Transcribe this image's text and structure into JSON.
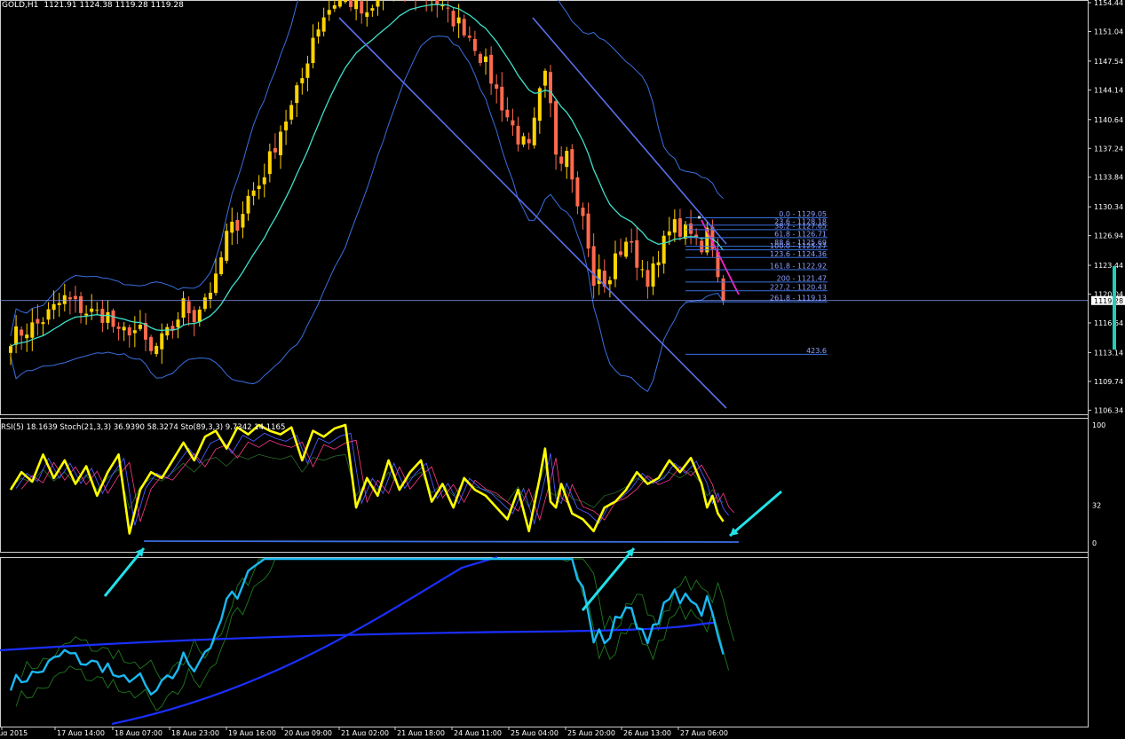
{
  "header": {
    "symbol": "GOLD,H1",
    "ohlc": "1121.91 1124.38 1119.28 1119.28",
    "current_price": "1119.28"
  },
  "rsi_header": {
    "label": "RSI(5) 18.1639  Stoch(21,3,3) 36.9390 58.3274  Sto(89,3,3) 9.7342 14.1165"
  },
  "rsi_axis_labels": [
    "100",
    "32",
    "0"
  ],
  "price_axis_labels": [
    "1154.44",
    "1151.04",
    "1147.54",
    "1144.14",
    "1140.64",
    "1137.24",
    "1133.84",
    "1130.34",
    "1126.94",
    "1123.44",
    "1120.04",
    "1116.64",
    "1113.14",
    "1109.74",
    "1106.34"
  ],
  "time_labels": [
    "14 Aug 2015",
    "17 Aug 14:00",
    "18 Aug 07:00",
    "18 Aug 23:00",
    "19 Aug 16:00",
    "20 Aug 09:00",
    "21 Aug 02:00",
    "21 Aug 18:00",
    "24 Aug 11:00",
    "25 Aug 04:00",
    "25 Aug 20:00",
    "26 Aug 13:00",
    "27 Aug 06:00"
  ],
  "fib_levels": [
    {
      "label": "0.0 - 1129.05",
      "price": 1129.05
    },
    {
      "label": "23.6 - 1128.18",
      "price": 1128.18
    },
    {
      "label": "38.2 - 1127.65",
      "price": 1127.65
    },
    {
      "label": "61.8 - 1126.71",
      "price": 1126.71
    },
    {
      "label": "88.6 - 1125.69",
      "price": 1125.69
    },
    {
      "label": "100.0 - 1125.27",
      "price": 1125.27
    },
    {
      "label": "123.6 - 1124.36",
      "price": 1124.36
    },
    {
      "label": "161.8 - 1122.92",
      "price": 1122.92
    },
    {
      "label": "200 - 1121.47",
      "price": 1121.47
    },
    {
      "label": "227.2 - 1120.43",
      "price": 1120.43
    },
    {
      "label": "261.8 - 1119.13",
      "price": 1119.13
    },
    {
      "label": "423.6",
      "price": 1112.94
    }
  ],
  "colors": {
    "background": "#000000",
    "bull_candle": "#ffd400",
    "bear_candle": "#ff6a4d",
    "ema": "#3fe0c8",
    "bands": "#3a6fe0",
    "trendline": "#5a6ee8",
    "magenta": "#ff22cc",
    "rsi_yellow": "#ffff00",
    "cyan_arrow": "#22e0e8",
    "lower_cyan": "#1ab8f0",
    "lower_blue": "#1a2fff",
    "lower_green": "#1f7a1f",
    "price_line": "#8aa0ff",
    "axis_text": "#ffffff"
  },
  "chart_data": [
    {
      "type": "candlestick",
      "title": "GOLD,H1",
      "ylim": [
        1106.34,
        1154.44
      ],
      "yticks": [
        1154.44,
        1151.04,
        1147.54,
        1144.14,
        1140.64,
        1137.24,
        1133.84,
        1130.34,
        1126.94,
        1123.44,
        1120.04,
        1116.64,
        1113.14,
        1109.74,
        1106.34
      ],
      "x_ticks": [
        "14 Aug 2015",
        "17 Aug 14:00",
        "18 Aug 07:00",
        "18 Aug 23:00",
        "19 Aug 16:00",
        "20 Aug 09:00",
        "21 Aug 02:00",
        "21 Aug 18:00",
        "24 Aug 11:00",
        "25 Aug 04:00",
        "25 Aug 20:00",
        "26 Aug 13:00",
        "27 Aug 06:00"
      ],
      "close_path": [
        [
          0,
          1115.0
        ],
        [
          5,
          1116.5
        ],
        [
          10,
          1119.5
        ],
        [
          14,
          1118.0
        ],
        [
          18,
          1117.5
        ],
        [
          20,
          1115.0
        ],
        [
          22,
          1116.0
        ],
        [
          24,
          1115.5
        ],
        [
          26,
          1113.0
        ],
        [
          28,
          1114.5
        ],
        [
          30,
          1116.0
        ],
        [
          32,
          1118.8
        ],
        [
          34,
          1117.5
        ],
        [
          36,
          1119.8
        ],
        [
          38,
          1121.5
        ],
        [
          40,
          1127.0
        ],
        [
          42,
          1128.5
        ],
        [
          44,
          1131.5
        ],
        [
          46,
          1133.0
        ],
        [
          48,
          1136.0
        ],
        [
          50,
          1139.5
        ],
        [
          52,
          1142.0
        ],
        [
          54,
          1145.5
        ],
        [
          56,
          1150.5
        ],
        [
          58,
          1153.0
        ],
        [
          60,
          1154.5
        ],
        [
          62,
          1155.0
        ],
        [
          64,
          1154.0
        ],
        [
          66,
          1152.5
        ],
        [
          68,
          1154.5
        ],
        [
          70,
          1155.5
        ],
        [
          72,
          1156.5
        ],
        [
          74,
          1156.0
        ],
        [
          76,
          1155.0
        ],
        [
          78,
          1155.5
        ],
        [
          80,
          1153.5
        ],
        [
          82,
          1152.5
        ],
        [
          84,
          1151.5
        ],
        [
          86,
          1149.5
        ],
        [
          88,
          1147.0
        ],
        [
          90,
          1144.0
        ],
        [
          92,
          1141.0
        ],
        [
          94,
          1138.5
        ],
        [
          96,
          1137.0
        ],
        [
          97,
          1140.0
        ],
        [
          98,
          1143.5
        ],
        [
          99,
          1145.5
        ],
        [
          100,
          1142.0
        ],
        [
          101,
          1137.0
        ],
        [
          102,
          1136.5
        ],
        [
          103,
          1137.5
        ],
        [
          104,
          1134.5
        ],
        [
          105,
          1131.5
        ],
        [
          106,
          1129.0
        ],
        [
          107,
          1126.0
        ],
        [
          108,
          1120.5
        ],
        [
          109,
          1123.0
        ],
        [
          110,
          1120.5
        ],
        [
          112,
          1124.0
        ],
        [
          114,
          1126.5
        ],
        [
          116,
          1124.0
        ],
        [
          118,
          1122.0
        ],
        [
          120,
          1123.5
        ],
        [
          122,
          1128.5
        ],
        [
          124,
          1127.5
        ],
        [
          126,
          1127.0
        ],
        [
          128,
          1125.5
        ],
        [
          129,
          1128.5
        ],
        [
          130,
          1126.0
        ],
        [
          131,
          1121.91
        ],
        [
          132,
          1119.28
        ]
      ],
      "last_close": 1119.28
    },
    {
      "type": "line",
      "title": "RSI(5) 18.1639  Stoch(21,3,3) 36.9390 58.3274  Sto(89,3,3) 9.7342 14.1165",
      "ylim": [
        0,
        100
      ],
      "yticks": [
        100,
        32,
        0
      ],
      "rsi_path": [
        [
          0,
          45
        ],
        [
          2,
          60
        ],
        [
          4,
          52
        ],
        [
          6,
          75
        ],
        [
          8,
          55
        ],
        [
          10,
          70
        ],
        [
          12,
          50
        ],
        [
          14,
          65
        ],
        [
          16,
          40
        ],
        [
          18,
          60
        ],
        [
          20,
          75
        ],
        [
          22,
          8
        ],
        [
          24,
          45
        ],
        [
          26,
          60
        ],
        [
          28,
          55
        ],
        [
          30,
          70
        ],
        [
          32,
          85
        ],
        [
          34,
          70
        ],
        [
          36,
          90
        ],
        [
          38,
          95
        ],
        [
          40,
          80
        ],
        [
          42,
          98
        ],
        [
          44,
          92
        ],
        [
          46,
          100
        ],
        [
          48,
          95
        ],
        [
          50,
          92
        ],
        [
          52,
          98
        ],
        [
          54,
          70
        ],
        [
          56,
          95
        ],
        [
          58,
          90
        ],
        [
          60,
          97
        ],
        [
          62,
          100
        ],
        [
          64,
          30
        ],
        [
          66,
          55
        ],
        [
          68,
          40
        ],
        [
          70,
          70
        ],
        [
          72,
          45
        ],
        [
          74,
          60
        ],
        [
          76,
          70
        ],
        [
          78,
          35
        ],
        [
          80,
          50
        ],
        [
          82,
          30
        ],
        [
          84,
          55
        ],
        [
          86,
          45
        ],
        [
          88,
          40
        ],
        [
          90,
          30
        ],
        [
          92,
          20
        ],
        [
          94,
          45
        ],
        [
          96,
          10
        ],
        [
          98,
          55
        ],
        [
          99,
          80
        ],
        [
          100,
          35
        ],
        [
          101,
          30
        ],
        [
          102,
          50
        ],
        [
          104,
          25
        ],
        [
          106,
          20
        ],
        [
          108,
          10
        ],
        [
          110,
          30
        ],
        [
          112,
          35
        ],
        [
          114,
          45
        ],
        [
          116,
          60
        ],
        [
          118,
          50
        ],
        [
          120,
          55
        ],
        [
          122,
          70
        ],
        [
          124,
          60
        ],
        [
          126,
          72
        ],
        [
          128,
          50
        ],
        [
          129,
          30
        ],
        [
          130,
          40
        ],
        [
          131,
          25
        ],
        [
          132,
          18.16
        ]
      ],
      "rsi_last": 18.1639,
      "stoch_21": [
        36.939,
        58.3274
      ],
      "sto_89": [
        9.7342,
        14.1165
      ]
    }
  ]
}
